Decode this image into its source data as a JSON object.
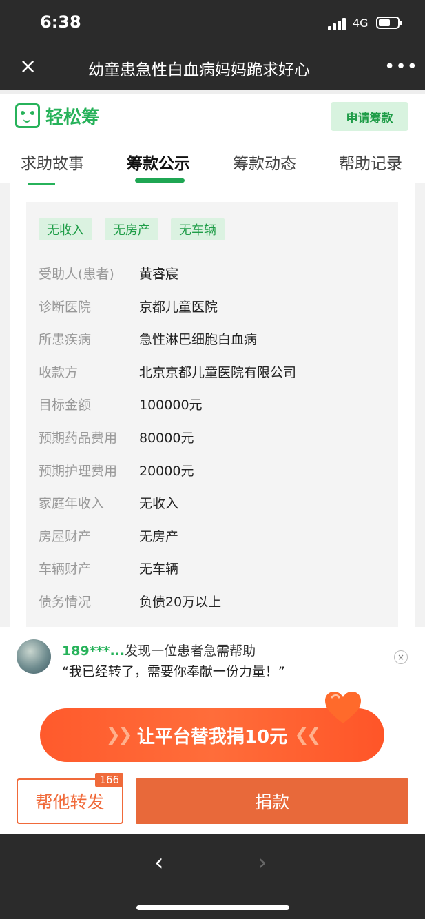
{
  "status": {
    "time": "6:38",
    "network": "4G"
  },
  "nav": {
    "close_icon": "×",
    "title": "幼童患急性白血病妈妈跪求好心",
    "more_icon": "•••"
  },
  "header": {
    "logo_text": "轻松筹",
    "apply_button": "申请筹款"
  },
  "tabs": [
    {
      "label": "求助故事"
    },
    {
      "label": "筹款公示"
    },
    {
      "label": "筹款动态"
    },
    {
      "label": "帮助记录"
    }
  ],
  "active_tab": "筹款公示",
  "tags": [
    "无收入",
    "无房产",
    "无车辆"
  ],
  "details": [
    {
      "key": "受助人(患者)",
      "value": "黄睿宸"
    },
    {
      "key": "诊断医院",
      "value": "京都儿童医院"
    },
    {
      "key": "所患疾病",
      "value": "急性淋巴细胞白血病"
    },
    {
      "key": "收款方",
      "value": "北京京都儿童医院有限公司"
    },
    {
      "key": "目标金额",
      "value": "100000元"
    },
    {
      "key": "预期药品费用",
      "value": "80000元"
    },
    {
      "key": "预期护理费用",
      "value": "20000元"
    },
    {
      "key": "家庭年收入",
      "value": "无收入"
    },
    {
      "key": "房屋财产",
      "value": "无房产"
    },
    {
      "key": "车辆财产",
      "value": "无车辆"
    },
    {
      "key": "债务情况",
      "value": "负债20万以上"
    }
  ],
  "notice": {
    "user": "189***...",
    "text": "发现一位患者急需帮助",
    "quote": "“我已经转了，需要你奉献一份力量！”",
    "close_icon": "×"
  },
  "platform_button": "让平台替我捐10元",
  "share_button": {
    "label": "帮他转发",
    "count": "166"
  },
  "donate_button": "捐款",
  "browser": {
    "back_icon": "‹",
    "forward_icon": "›"
  },
  "colors": {
    "brand_green": "#27b25a",
    "orange": "#e8693a",
    "dark_bar": "#2b2b2b"
  }
}
